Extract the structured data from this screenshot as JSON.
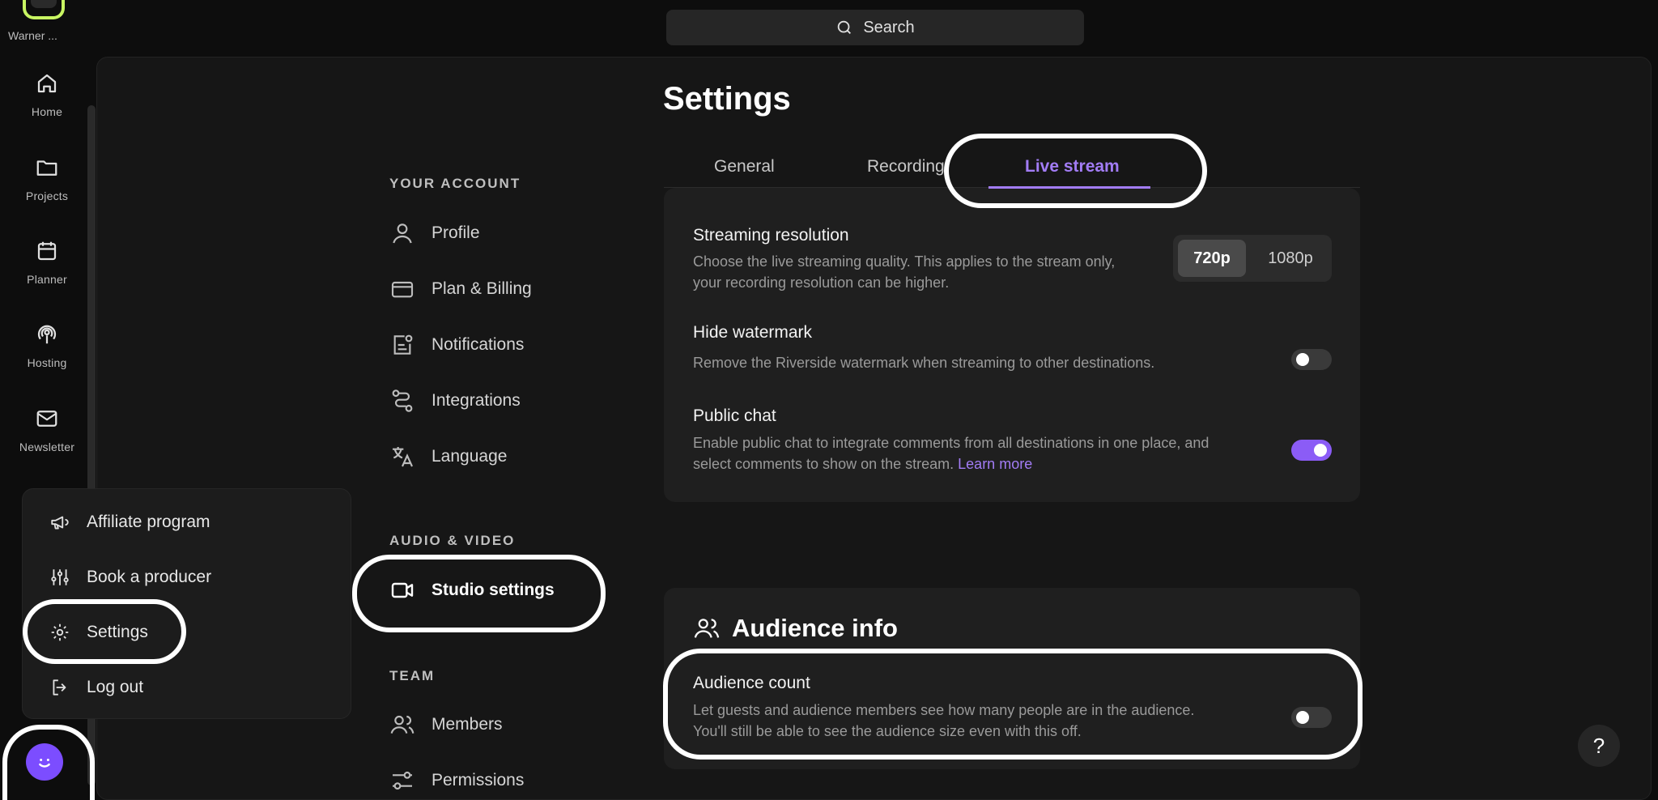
{
  "workspace": {
    "name": "Warner ..."
  },
  "rail": {
    "items": [
      {
        "label": "Home",
        "icon": "home-icon"
      },
      {
        "label": "Projects",
        "icon": "folder-icon"
      },
      {
        "label": "Planner",
        "icon": "calendar-icon"
      },
      {
        "label": "Hosting",
        "icon": "podcast-icon"
      },
      {
        "label": "Newsletter",
        "icon": "mail-icon"
      }
    ]
  },
  "search": {
    "label": "Search"
  },
  "page": {
    "title": "Settings"
  },
  "nav": {
    "your_account": "YOUR ACCOUNT",
    "profile": "Profile",
    "plan_billing": "Plan & Billing",
    "notifications": "Notifications",
    "integrations": "Integrations",
    "language": "Language",
    "audio_video": "AUDIO & VIDEO",
    "studio_settings": "Studio settings",
    "team": "TEAM",
    "members": "Members",
    "permissions": "Permissions"
  },
  "tabs": {
    "general": "General",
    "recording": "Recording",
    "live_stream": "Live stream"
  },
  "stream": {
    "resolution_title": "Streaming resolution",
    "resolution_desc_1": "Choose the live streaming quality. This applies to the stream only,",
    "resolution_desc_2": "your recording resolution can be higher.",
    "res_720": "720p",
    "res_1080": "1080p",
    "watermark_title": "Hide watermark",
    "watermark_desc": "Remove the Riverside watermark when streaming to other destinations.",
    "watermark_on": false,
    "chat_title": "Public chat",
    "chat_desc_1": "Enable public chat to integrate comments from all destinations in one place, and",
    "chat_desc_2": "select comments to show on the stream.",
    "chat_link": "Learn more",
    "chat_on": true
  },
  "audience": {
    "heading": "Audience info",
    "count_title": "Audience count",
    "count_desc_1": "Let guests and audience members see how many people are in the audience.",
    "count_desc_2": "You'll still be able to see the audience size even with this off.",
    "count_on": false
  },
  "menu": {
    "affiliate": "Affiliate program",
    "producer": "Book a producer",
    "settings": "Settings",
    "logout": "Log out"
  },
  "help": {
    "label": "?"
  },
  "colors": {
    "accent": "#a27cf5",
    "toggle_on": "#8b5cf6",
    "logo": "#c8f562"
  }
}
